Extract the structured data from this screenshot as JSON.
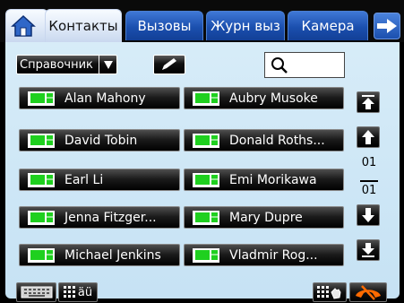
{
  "tabs": [
    {
      "label": "Контакты",
      "active": true
    },
    {
      "label": "Вызовы",
      "active": false
    },
    {
      "label": "Журн выз",
      "active": false
    },
    {
      "label": "Камера",
      "active": false
    }
  ],
  "icons": {
    "home": "home-icon",
    "next": "arrow-right-icon",
    "edit": "pencil-icon",
    "search": "search-icon",
    "video": "video-call-icon",
    "keyboard": "keyboard-icon",
    "language": "language-icon",
    "dialpad": "dialpad-icon",
    "hangup": "hangup-icon"
  },
  "toolbar": {
    "directory_value": "Справочник",
    "search_value": ""
  },
  "contacts": [
    "Alan Mahony",
    "Aubry Musoke",
    "David Tobin",
    "Donald Roths...",
    "Earl Li",
    "Emi Morikawa",
    "Jenna Fitzger...",
    "Mary Dupre",
    "Michael Jenkins",
    "Vladmir Rog..."
  ],
  "pager": {
    "current": "01",
    "total": "01"
  },
  "bottom": {
    "language_label": "äü"
  },
  "colors": {
    "tab_blue": "#1b4fae",
    "panel_bg": "#cfe7f6",
    "video_green": "#1fd01f",
    "hangup_orange": "#ff6a00"
  }
}
